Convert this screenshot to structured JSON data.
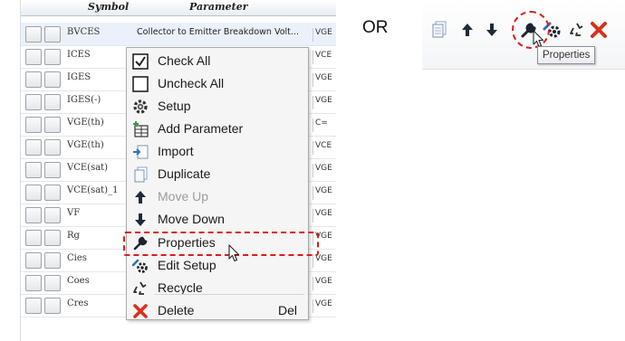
{
  "table": {
    "headers": {
      "symbol": "Symbol",
      "parameter": "Parameter"
    },
    "rows": [
      {
        "symbol": "BVCES",
        "parameter": "Collector to Emitter Breakdown Volt...",
        "condition": "VGE",
        "selected": true
      },
      {
        "symbol": "ICES",
        "parameter": "",
        "condition": "VCE"
      },
      {
        "symbol": "IGES",
        "parameter": "",
        "condition": "VGE"
      },
      {
        "symbol": "IGES(-)",
        "parameter": "",
        "condition": "VGE"
      },
      {
        "symbol": "VGE(th)",
        "parameter": "",
        "condition": "C="
      },
      {
        "symbol": "VGE(th)",
        "parameter": "",
        "condition": "VCE"
      },
      {
        "symbol": "VCE(sat)",
        "parameter": "",
        "condition": "VGE"
      },
      {
        "symbol": "VCE(sat)_1",
        "parameter": "",
        "condition": "VGE"
      },
      {
        "symbol": "VF",
        "parameter": "",
        "condition": "VGE"
      },
      {
        "symbol": "Rg",
        "parameter": "",
        "condition": "VGE"
      },
      {
        "symbol": "Cies",
        "parameter": "",
        "condition": "VGE"
      },
      {
        "symbol": "Coes",
        "parameter": "",
        "condition": "VGE"
      },
      {
        "symbol": "Cres",
        "parameter": "",
        "condition": "VGE"
      }
    ]
  },
  "context_menu": {
    "items": [
      {
        "label": "Check All",
        "icon": "checkbox-checked-icon",
        "enabled": true
      },
      {
        "label": "Uncheck All",
        "icon": "checkbox-empty-icon",
        "enabled": true
      },
      {
        "label": "Setup",
        "icon": "gear-icon",
        "enabled": true
      },
      {
        "label": "Add Parameter",
        "icon": "add-table-icon",
        "enabled": true
      },
      {
        "label": "Import",
        "icon": "import-icon",
        "enabled": true
      },
      {
        "label": "Duplicate",
        "icon": "duplicate-icon",
        "enabled": true
      },
      {
        "label": "Move Up",
        "icon": "arrow-up-icon",
        "enabled": false
      },
      {
        "label": "Move Down",
        "icon": "arrow-down-icon",
        "enabled": true
      },
      {
        "label": "Properties",
        "icon": "wrench-icon",
        "enabled": true,
        "highlighted": true
      },
      {
        "label": "Edit Setup",
        "icon": "gear-wrench-icon",
        "enabled": true
      },
      {
        "label": "Recycle",
        "icon": "recycle-icon",
        "enabled": true
      },
      {
        "label": "Delete",
        "icon": "close-x-icon",
        "enabled": true,
        "shortcut": "Del"
      }
    ]
  },
  "or_label": "OR",
  "toolbar": {
    "buttons": [
      "duplicate-icon",
      "arrow-up-icon",
      "arrow-down-icon",
      "wrench-icon",
      "gear-wrench-icon",
      "recycle-icon",
      "close-x-icon"
    ],
    "tooltip": "Properties"
  },
  "colors": {
    "highlight": "#e01a1a",
    "accent_blue": "#2f6fc0",
    "delete_red": "#d9301c"
  }
}
